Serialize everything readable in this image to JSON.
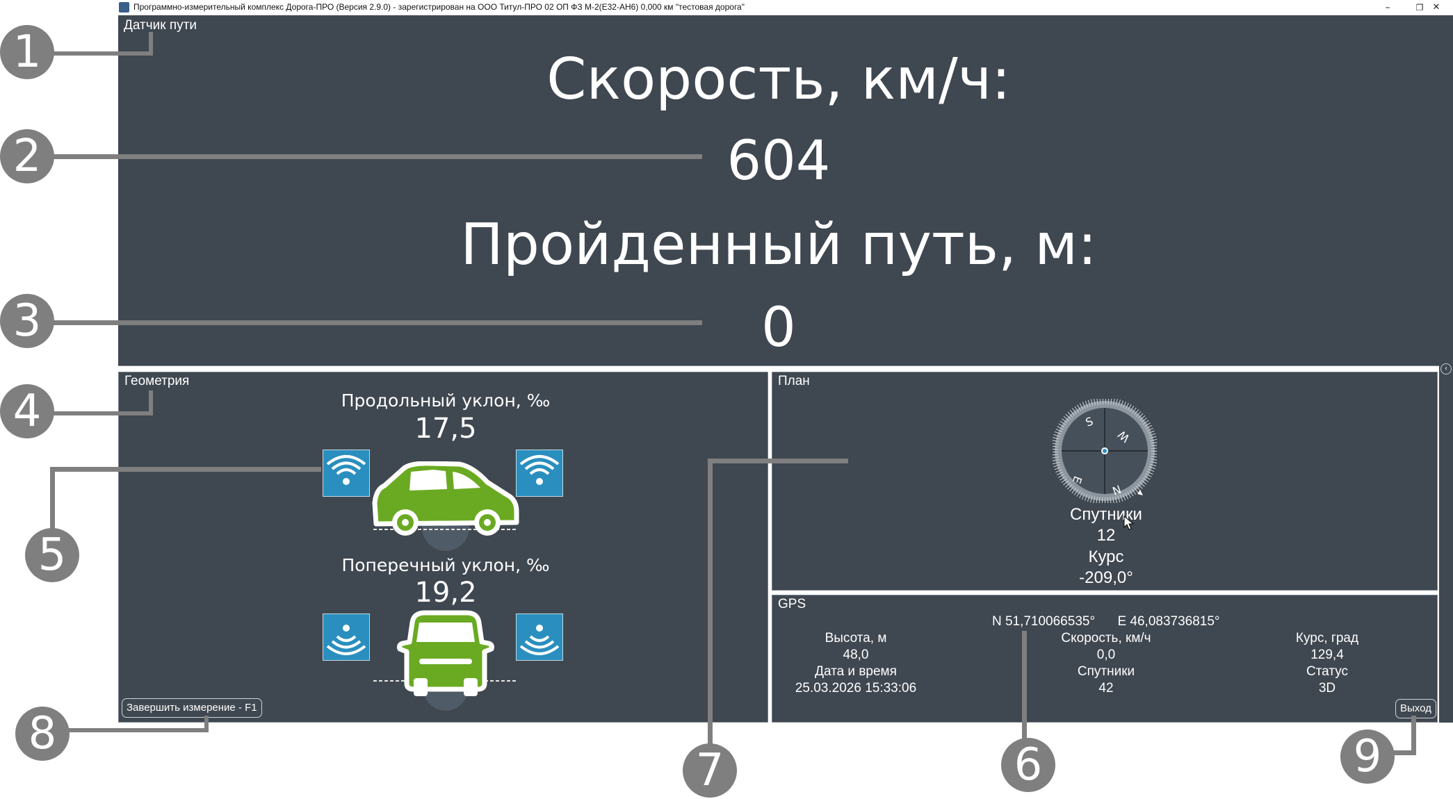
{
  "window": {
    "title": "Программно-измерительный комплекс Дорога-ПРО (Версия 2.9.0) - зарегистрирован на ООО Титул-ПРО 02 ОП ФЗ М-2(Е32-АН6) 0,000 км \"тестовая дорога\"",
    "minimize": "–",
    "restore": "❐",
    "close": "✕"
  },
  "sensor": {
    "label": "Датчик пути",
    "speed_title": "Скорость, км/ч:",
    "speed_value": "604",
    "distance_title": "Пройденный путь, м:",
    "distance_value": "0"
  },
  "geometry": {
    "label": "Геометрия",
    "long_slope_title": "Продольный уклон, ‰",
    "long_slope_value": "17,5",
    "cross_slope_title": "Поперечный уклон, ‰",
    "cross_slope_value": "19,2",
    "finish_button": "Завершить измерение - F1"
  },
  "plan": {
    "label": "План",
    "compass_letters": [
      "S",
      "W",
      "E",
      "N"
    ],
    "satellites_title": "Спутники",
    "satellites_value": "12",
    "course_title": "Курс",
    "course_value": "-209,0°"
  },
  "gps": {
    "label": "GPS",
    "lat": "N 51,710066535°",
    "lon": "E 46,083736815°",
    "altitude_title": "Высота, м",
    "altitude_value": "48,0",
    "datetime_title": "Дата и время",
    "datetime_value": "25.03.2026 15:33:06",
    "speed_title": "Скорость, км/ч",
    "speed_value": "0,0",
    "satellites_title": "Спутники",
    "satellites_value": "42",
    "course_title": "Курс, град",
    "course_value": "129,4",
    "status_title": "Статус",
    "status_value": "3D",
    "exit_button": "Выход"
  },
  "callouts": [
    "1",
    "2",
    "3",
    "4",
    "5",
    "6",
    "7",
    "8",
    "9"
  ],
  "colors": {
    "panel": "#3f4750",
    "accent_green": "#6aaa22",
    "sensor_blue": "#2a8fbf",
    "callout_gray": "#7f7f7f"
  }
}
